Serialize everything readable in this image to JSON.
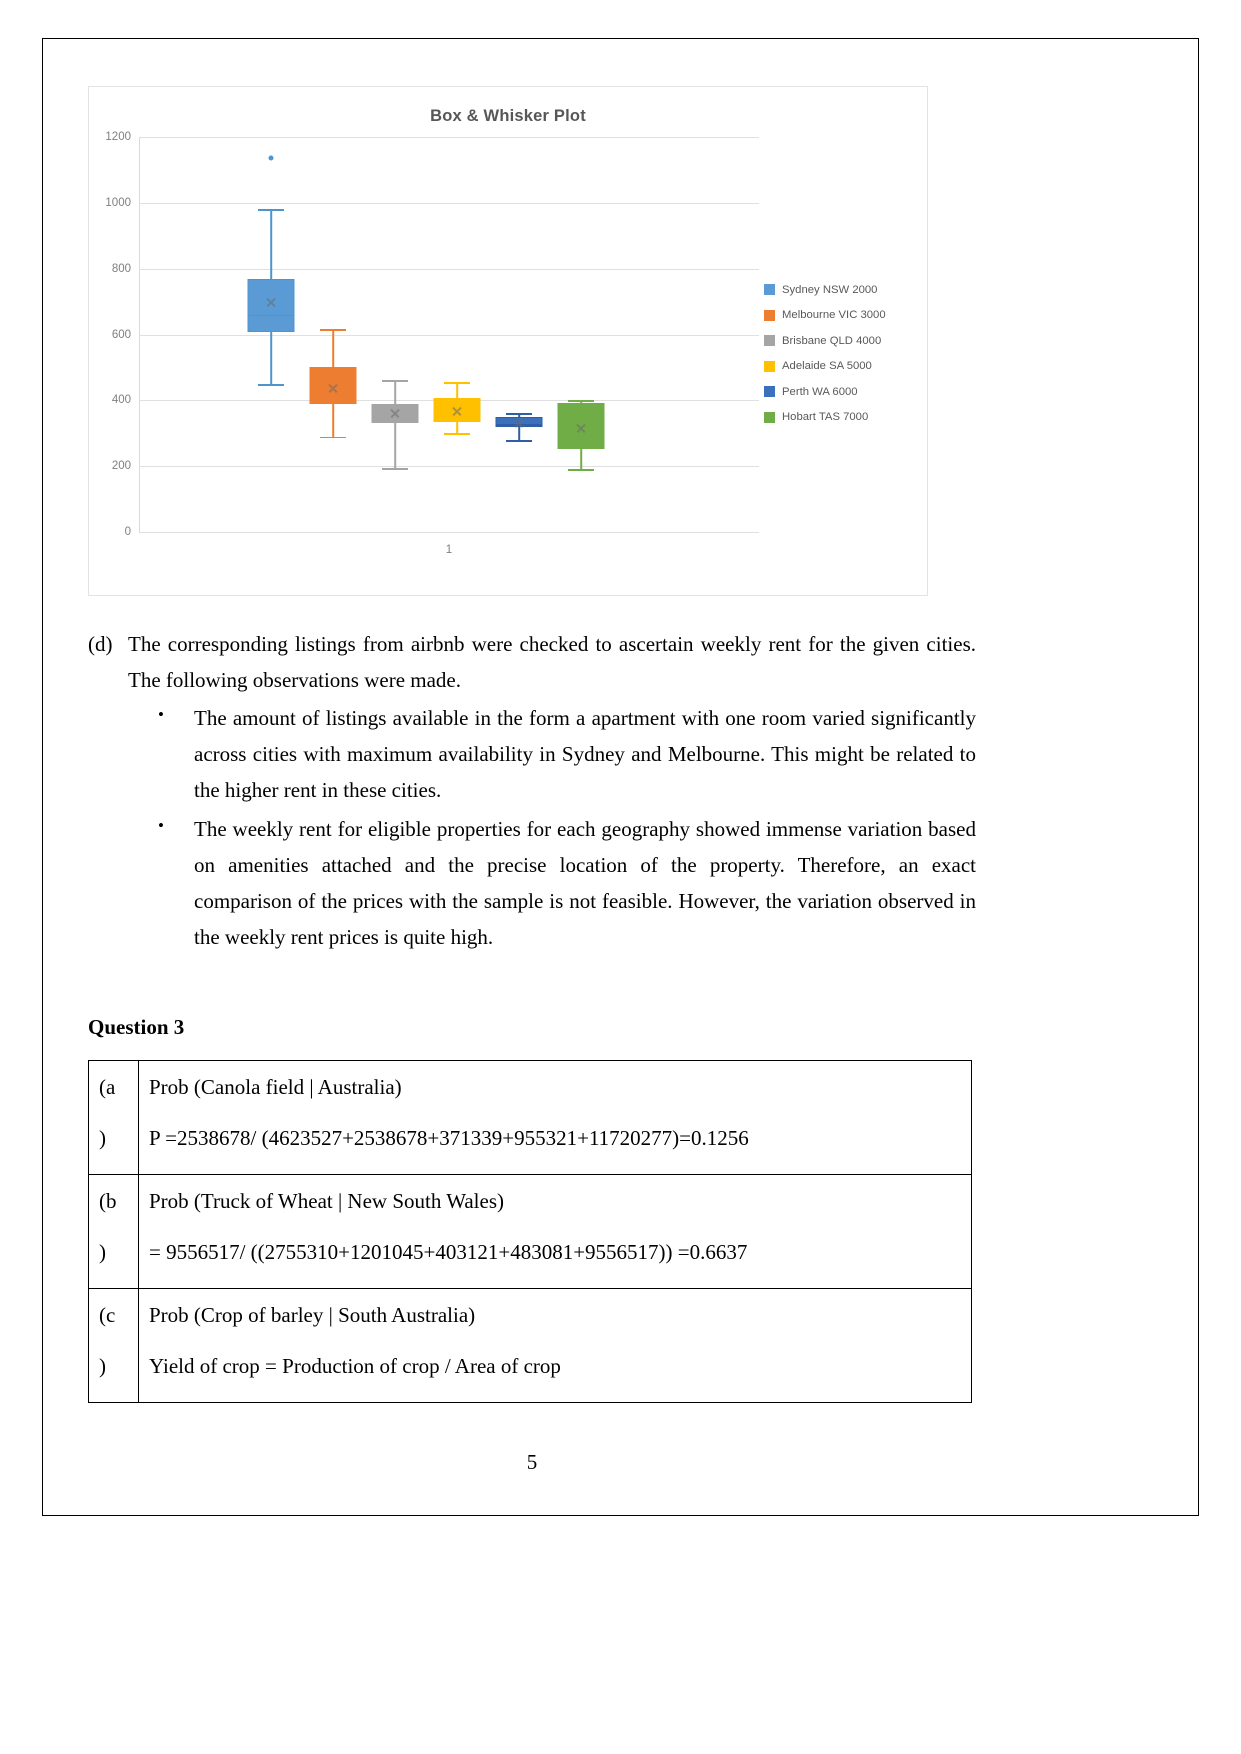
{
  "chart_data": {
    "type": "box",
    "title": "Box & Whisker Plot",
    "xlabel": "",
    "ylabel": "",
    "xtick_labels": [
      "1"
    ],
    "ylim": [
      0,
      1200
    ],
    "yticks": [
      0,
      200,
      400,
      600,
      800,
      1000,
      1200
    ],
    "grid": true,
    "legend_position": "right",
    "series": [
      {
        "name": "Sydney NSW 2000",
        "color": "#4F94CD",
        "fill": "#5B9BD5",
        "whisker_low": 450,
        "q1": 608,
        "median": 663,
        "mean": 700,
        "q3": 770,
        "whisker_high": 982,
        "outliers": [
          1150
        ]
      },
      {
        "name": "Melbourne VIC 3000",
        "color": "#ED7D31",
        "fill": "#ED7D31",
        "whisker_low": 290,
        "q1": 388,
        "median": 423,
        "mean": 440,
        "q3": 500,
        "whisker_high": 617,
        "outliers": []
      },
      {
        "name": "Brisbane QLD 4000",
        "color": "#A5A5A5",
        "fill": "#A5A5A5",
        "whisker_low": 193,
        "q1": 330,
        "median": 352,
        "mean": 362,
        "q3": 390,
        "whisker_high": 462,
        "outliers": []
      },
      {
        "name": "Adelaide SA 5000",
        "color": "#FFC000",
        "fill": "#FFC000",
        "whisker_low": 300,
        "q1": 335,
        "median": 350,
        "mean": 368,
        "q3": 407,
        "whisker_high": 455,
        "outliers": []
      },
      {
        "name": "Perth WA 6000",
        "color": "#2E5FA3",
        "fill": "#3D6FBF",
        "whisker_low": 280,
        "q1": 318,
        "median": 330,
        "mean": 333,
        "q3": 350,
        "whisker_high": 362,
        "outliers": []
      },
      {
        "name": "Hobart TAS 7000",
        "color": "#70AD47",
        "fill": "#70AD47",
        "whisker_low": 190,
        "q1": 252,
        "median": 318,
        "mean": 318,
        "q3": 392,
        "whisker_high": 400,
        "outliers": []
      }
    ]
  },
  "content": {
    "item_d": {
      "marker": "(d)",
      "text": "The corresponding listings from airbnb were checked to ascertain weekly rent for the given cities. The following observations were made."
    },
    "bullets": [
      "The amount of listings available in the form a apartment with one room varied significantly across cities with maximum availability in Sydney and Melbourne. This might be related to the higher rent in these cities.",
      "The weekly rent for eligible properties for each geography showed immense variation based on amenities attached and the precise location of the property. Therefore, an exact comparison of the prices with the sample is not feasible. However, the variation observed in the weekly rent prices is quite high."
    ],
    "question_heading": "Question 3",
    "table_rows": [
      {
        "label_top": "(a",
        "label_bottom": ")",
        "line1": "Prob (Canola field | Australia)",
        "line2": "P =2538678/ (4623527+2538678+371339+955321+11720277)=0.1256"
      },
      {
        "label_top": "(b",
        "label_bottom": ")",
        "line1": "Prob (Truck of Wheat | New South Wales)",
        "line2": "= 9556517/ ((2755310+1201045+403121+483081+9556517)) =0.6637"
      },
      {
        "label_top": "(c",
        "label_bottom": ")",
        "line1": "Prob (Crop of barley | South Australia)",
        "line2": "Yield of crop = Production of crop / Area of crop"
      }
    ],
    "page_number": "5"
  }
}
